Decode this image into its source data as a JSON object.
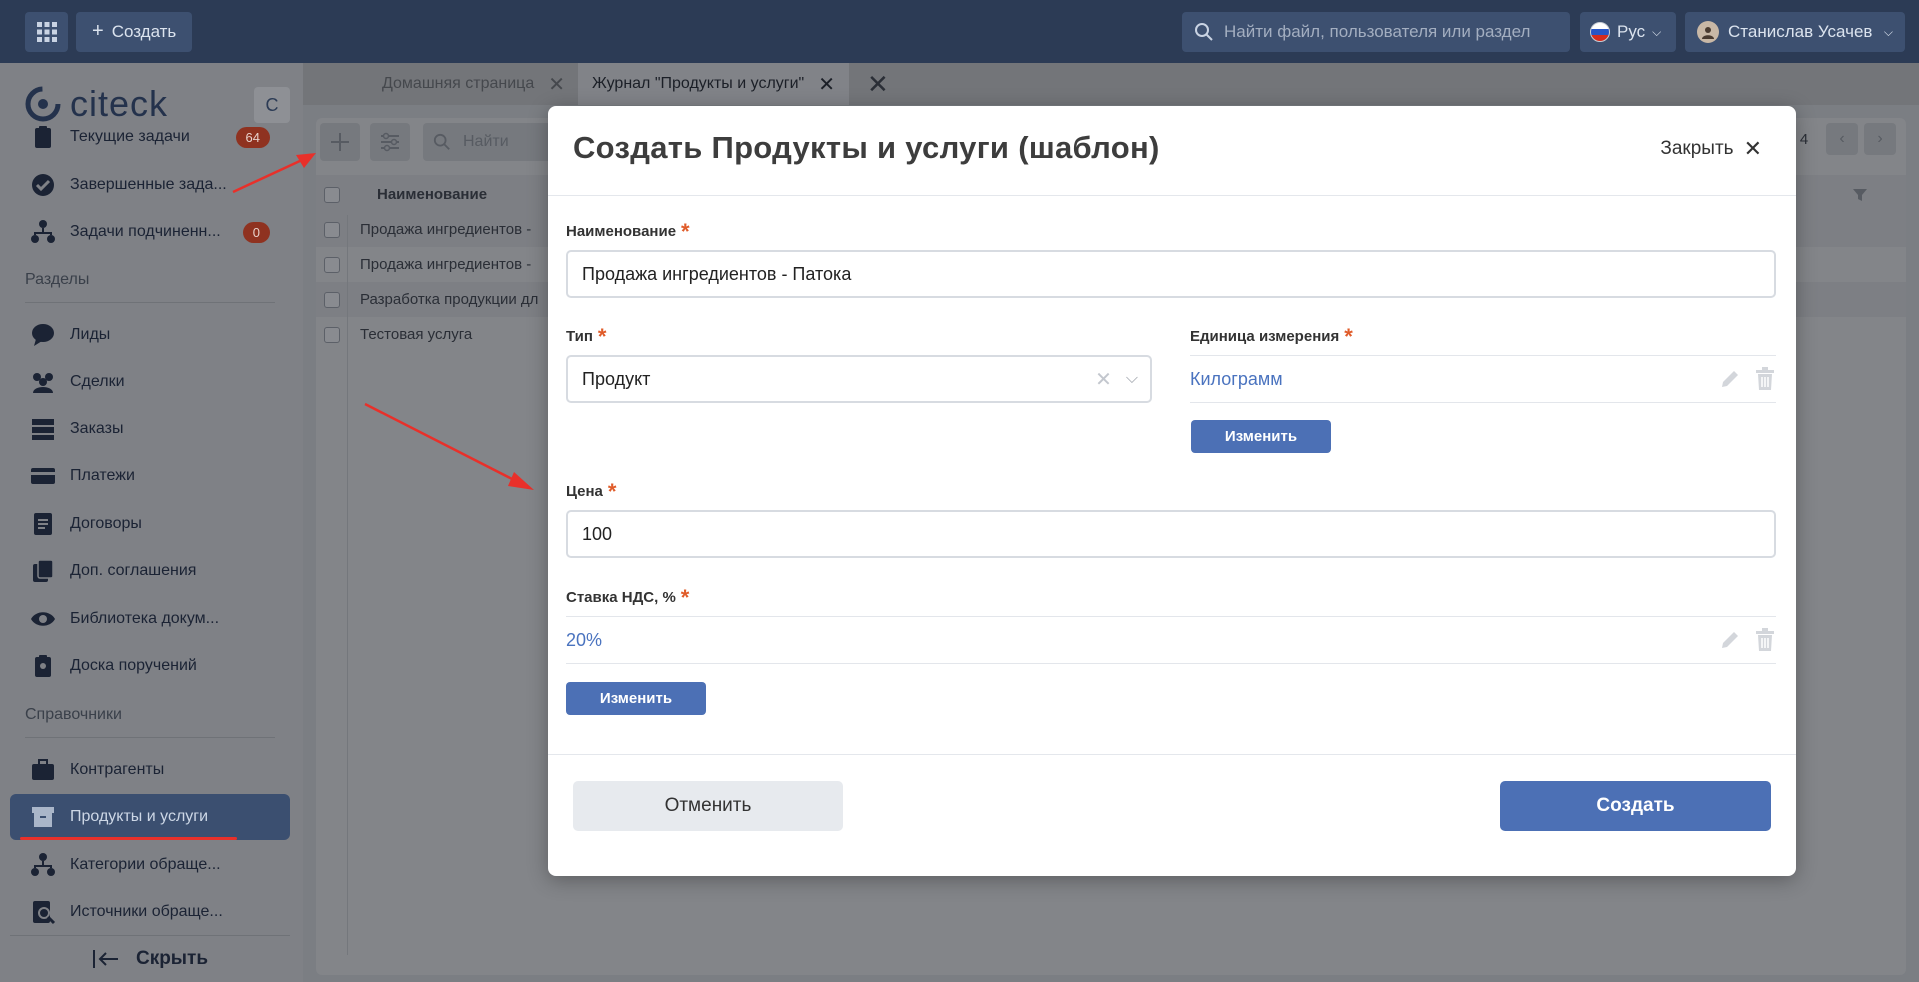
{
  "topbar": {
    "create_label": "Создать",
    "search_placeholder": "Найти файл, пользователя или раздел",
    "language": "Рус",
    "user_name": "Станислав Усачев"
  },
  "sidebar": {
    "logo_text": "citeck",
    "collapse_letter": "С",
    "task_items": [
      {
        "label": "Текущие задачи",
        "badge": "64",
        "icon": "clipboard-icon"
      },
      {
        "label": "Завершенные зада...",
        "icon": "check-circle-icon"
      },
      {
        "label": "Задачи подчиненн...",
        "badge": "0",
        "icon": "org-icon"
      }
    ],
    "section_sections": "Разделы",
    "section_items": [
      {
        "label": "Лиды",
        "icon": "chat-icon"
      },
      {
        "label": "Сделки",
        "icon": "users-icon"
      },
      {
        "label": "Заказы",
        "icon": "server-icon"
      },
      {
        "label": "Платежи",
        "icon": "card-icon"
      },
      {
        "label": "Договоры",
        "icon": "document-icon"
      },
      {
        "label": "Доп. соглашения",
        "icon": "documents-icon"
      },
      {
        "label": "Библиотека докум...",
        "icon": "eye-icon"
      },
      {
        "label": "Доска поручений",
        "icon": "clipboard-user-icon"
      }
    ],
    "section_refs": "Справочники",
    "ref_items": [
      {
        "label": "Контрагенты",
        "icon": "briefcase-icon"
      },
      {
        "label": "Продукты и услуги",
        "icon": "box-icon"
      },
      {
        "label": "Категории обраще...",
        "icon": "org-icon"
      },
      {
        "label": "Источники обраще...",
        "icon": "search-doc-icon"
      }
    ],
    "hide_label": "Скрыть"
  },
  "tabs": [
    {
      "label": "Домашняя страница"
    },
    {
      "label": "Журнал \"Продукты и услуги\""
    }
  ],
  "journal": {
    "search_placeholder": "Найти",
    "column_name": "Наименование",
    "page_count": "4",
    "rows": [
      "Продажа ингредиентов - ",
      "Продажа ингредиентов - ",
      "Разработка продукции дл",
      "Тестовая услуга"
    ]
  },
  "modal": {
    "title": "Создать Продукты и услуги (шаблон)",
    "close_label": "Закрыть",
    "name_label": "Наименование",
    "name_value": "Продажа ингредиентов - Патока",
    "type_label": "Тип",
    "type_value": "Продукт",
    "unit_label": "Единица измерения",
    "unit_value": "Килограмм",
    "change_label": "Изменить",
    "price_label": "Цена",
    "price_value": "100",
    "vat_label": "Ставка НДС, %",
    "vat_value": "20%",
    "cancel_label": "Отменить",
    "create_label": "Создать",
    "required_mark": "*"
  },
  "colors": {
    "accent": "#4c70b5",
    "topbar": "#2c3b55",
    "required": "#e05c2a",
    "annotation_arrow": "#e8302a"
  }
}
